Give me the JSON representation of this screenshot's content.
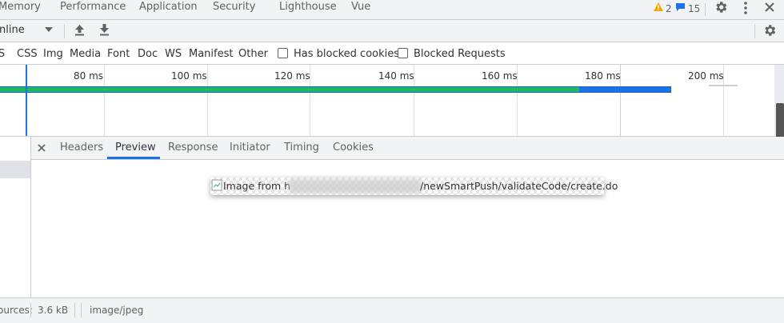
{
  "top_tabs": [
    "Memory",
    "Performance",
    "Application",
    "Security",
    "Lighthouse",
    "Vue"
  ],
  "issues": {
    "warnings": "2",
    "messages": "15"
  },
  "toolbar": {
    "throttle_value": "nline"
  },
  "filter_types": [
    "JS",
    "CSS",
    "Img",
    "Media",
    "Font",
    "Doc",
    "WS",
    "Manifest",
    "Other"
  ],
  "filter_checks": {
    "blocked_cookies": "Has blocked cookies",
    "blocked_requests": "Blocked Requests"
  },
  "timeline": {
    "ticks": [
      "80 ms",
      "100 ms",
      "120 ms",
      "140 ms",
      "160 ms",
      "180 ms",
      "200 ms"
    ]
  },
  "detail_tabs": [
    "Headers",
    "Preview",
    "Response",
    "Initiator",
    "Timing",
    "Cookies"
  ],
  "preview": {
    "alt_prefix": "Image from h",
    "alt_suffix": "/newSmartPush/validateCode/create.do"
  },
  "status": {
    "resources": "ources:",
    "size": "3.6 kB",
    "mime": "image/jpeg"
  },
  "colors": {
    "accent": "#1a73e8",
    "bar_green": "#1eb85d",
    "bar_blue": "#1a73e8",
    "warning": "#f2a600"
  }
}
